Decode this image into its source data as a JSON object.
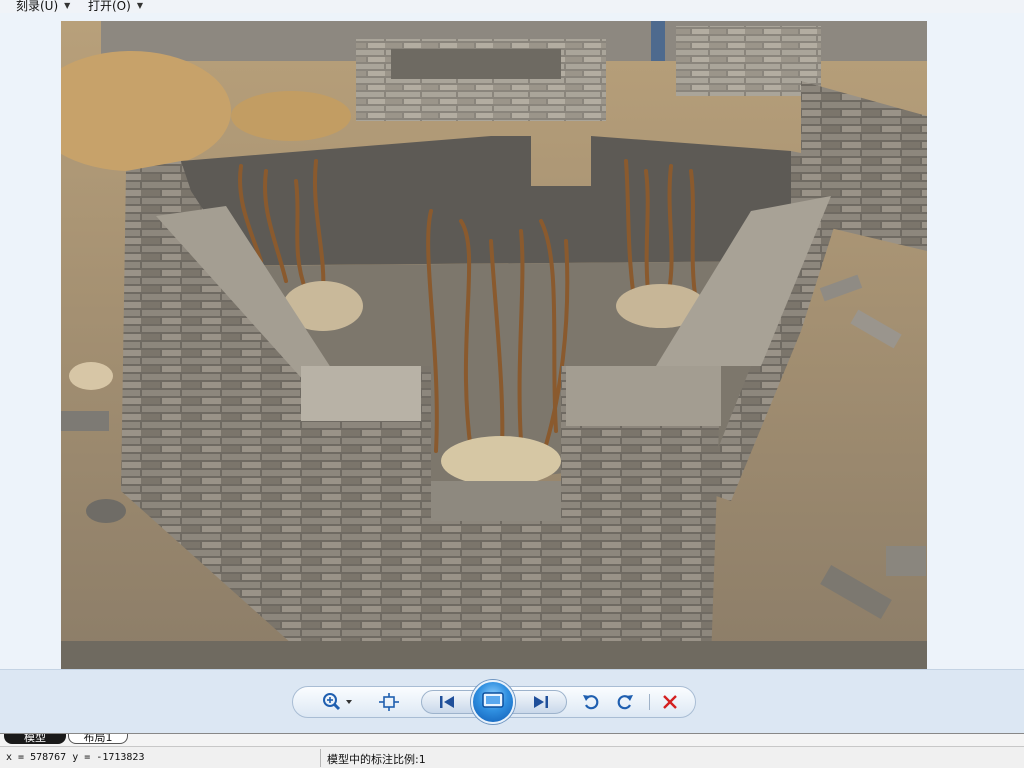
{
  "menu": {
    "items": [
      {
        "label": "刻录(U)"
      },
      {
        "label": "打开(O)"
      }
    ]
  },
  "viewer": {
    "image_subject": "brick masonry foundation under construction with rebar"
  },
  "toolbar": {
    "icons": [
      "zoom-icon",
      "fit-window-icon",
      "previous-icon",
      "slideshow-icon",
      "next-icon",
      "rotate-left-icon",
      "rotate-right-icon",
      "delete-icon"
    ],
    "accent": "#1f6fd0",
    "delete_color": "#d42020"
  },
  "tabs": [
    {
      "label": "模型",
      "active": true
    },
    {
      "label": "布局1",
      "active": false
    }
  ],
  "status": {
    "coordinates": "x = 578767  y = -1713823",
    "annotation_scale": "模型中的标注比例:1"
  }
}
